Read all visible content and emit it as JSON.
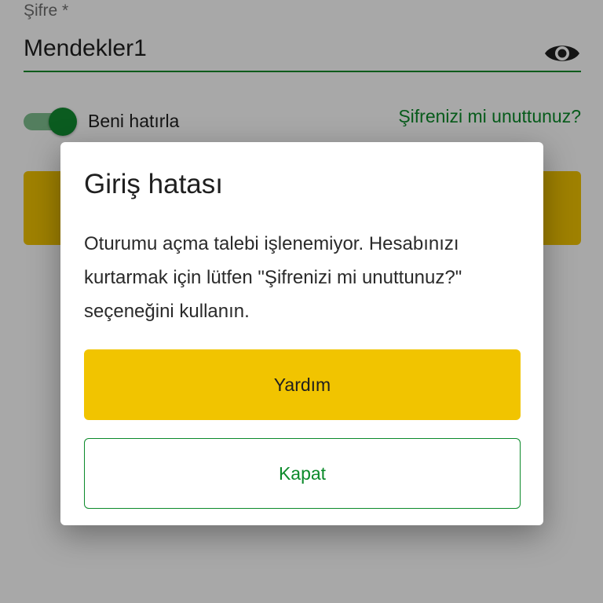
{
  "password_field": {
    "label": "Şifre *",
    "value": "Mendekler1",
    "visibility_icon": "eye-icon"
  },
  "remember_me": {
    "label": "Beni hatırla",
    "checked": true
  },
  "forgot_password_link": "Şifrenizi mi unuttunuz?",
  "dialog": {
    "title": "Giriş hatası",
    "message": "Oturumu açma talebi işlenemiyor. Hesabınızı kurtarmak için lütfen \"Şifrenizi mi unuttunuz?\" seçeneğini kullanın.",
    "help_button_label": "Yardım",
    "close_button_label": "Kapat"
  },
  "colors": {
    "accent_green": "#0b8a2a",
    "primary_yellow": "#f1c400"
  }
}
